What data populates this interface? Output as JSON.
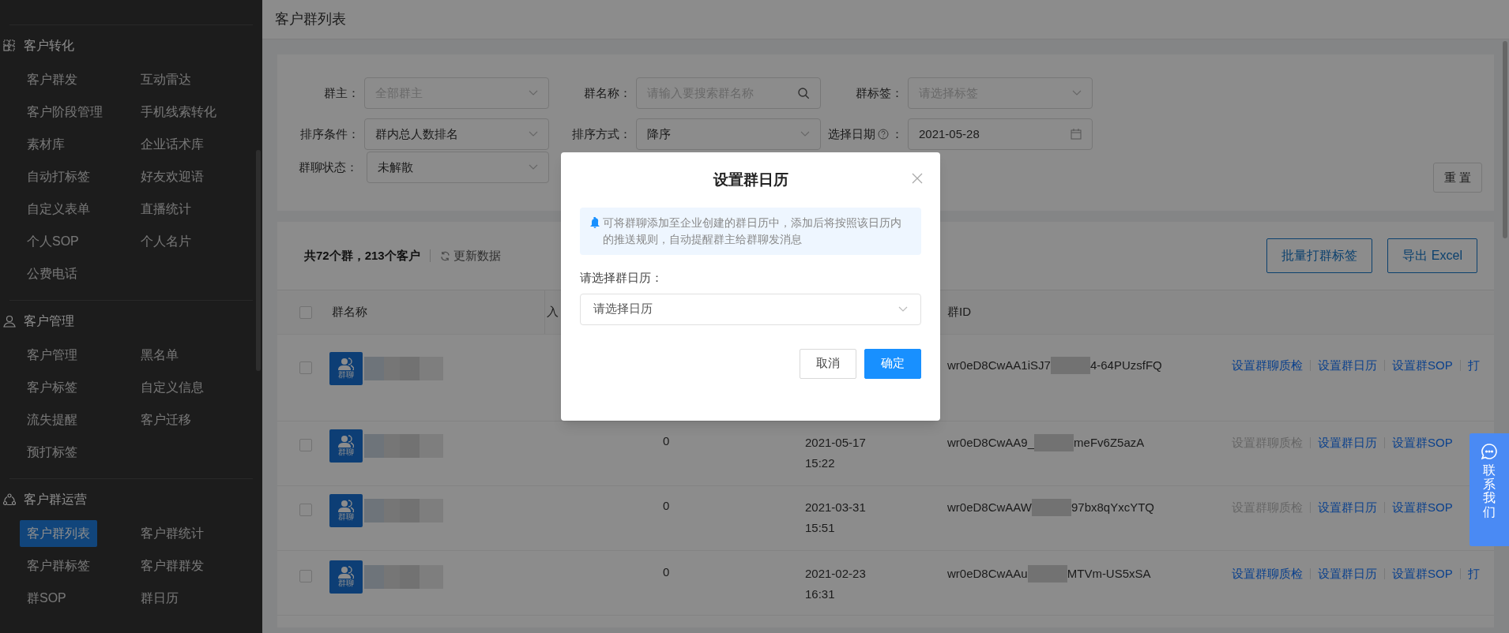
{
  "sidebar": {
    "sections": [
      {
        "title": "客户转化",
        "items": [
          {
            "label": "客户群发",
            "selected": false
          },
          {
            "label": "互动雷达",
            "selected": false
          },
          {
            "label": "客户阶段管理",
            "selected": false
          },
          {
            "label": "手机线索转化",
            "selected": false
          },
          {
            "label": "素材库",
            "selected": false
          },
          {
            "label": "企业话术库",
            "selected": false
          },
          {
            "label": "自动打标签",
            "selected": false
          },
          {
            "label": "好友欢迎语",
            "selected": false
          },
          {
            "label": "自定义表单",
            "selected": false
          },
          {
            "label": "直播统计",
            "selected": false
          },
          {
            "label": "个人SOP",
            "selected": false
          },
          {
            "label": "个人名片",
            "selected": false
          },
          {
            "label": "公费电话",
            "selected": false
          }
        ]
      },
      {
        "title": "客户管理",
        "items": [
          {
            "label": "客户管理",
            "selected": false
          },
          {
            "label": "黑名单",
            "selected": false
          },
          {
            "label": "客户标签",
            "selected": false
          },
          {
            "label": "自定义信息",
            "selected": false
          },
          {
            "label": "流失提醒",
            "selected": false
          },
          {
            "label": "客户迁移",
            "selected": false
          },
          {
            "label": "预打标签",
            "selected": false
          }
        ]
      },
      {
        "title": "客户群运营",
        "items": [
          {
            "label": "客户群列表",
            "selected": true
          },
          {
            "label": "客户群统计",
            "selected": false
          },
          {
            "label": "客户群标签",
            "selected": false
          },
          {
            "label": "客户群群发",
            "selected": false
          },
          {
            "label": "群SOP",
            "selected": false
          },
          {
            "label": "群日历",
            "selected": false
          }
        ]
      }
    ]
  },
  "page_header": {
    "title": "客户群列表"
  },
  "filters": [
    {
      "label": "群主：",
      "kind": "select",
      "placeholder": "全部群主",
      "help_icon": false
    },
    {
      "label": "群名称：",
      "kind": "search",
      "placeholder": "请输入要搜索群名称",
      "help_icon": false
    },
    {
      "label": "群标签：",
      "kind": "select",
      "placeholder": "请选择标签",
      "help_icon": false
    },
    {
      "label": "排序条件：",
      "kind": "select",
      "value": "群内总人数排名",
      "help_icon": false
    },
    {
      "label": "排序方式：",
      "kind": "select",
      "value": "降序",
      "help_icon": false
    },
    {
      "label": "选择日期",
      "kind": "date",
      "value": "2021-05-28",
      "help_icon": true,
      "label_suffix": "："
    },
    {
      "label": "群聊状态：",
      "kind": "select",
      "value": "未解散",
      "help_icon": false
    }
  ],
  "reset_button": "重 置",
  "summary": {
    "text": "共72个群，213个客户",
    "refresh": "更新数据"
  },
  "toolbar_buttons": [
    "批量打群标签",
    "导出 Excel"
  ],
  "table": {
    "all_checked": false,
    "header": {
      "name": "群名称",
      "column_2": "入",
      "group_id": "群ID"
    },
    "rows": [
      {
        "checked": false,
        "avatar_label": "群聊",
        "id_start": "wr0eD8CwAA1iSJ7",
        "id_end": "4-64PUzsfFQ",
        "actions": [
          {
            "label": "设置群聊质检",
            "disabled": false
          },
          {
            "label": "设置群日历",
            "disabled": false
          },
          {
            "label": "设置群SOP",
            "disabled": false
          },
          {
            "label": "打",
            "disabled": false
          }
        ]
      },
      {
        "checked": false,
        "avatar_label": "群聊",
        "count": "0",
        "date": "2021-05-17",
        "time": "15:22",
        "id_start": "wr0eD8CwAA9_",
        "id_end": "meFv6Z5azA",
        "actions": [
          {
            "label": "设置群聊质检",
            "disabled": true
          },
          {
            "label": "设置群日历",
            "disabled": false
          },
          {
            "label": "设置群SOP",
            "disabled": false
          }
        ]
      },
      {
        "checked": false,
        "avatar_label": "群聊",
        "count": "0",
        "date": "2021-03-31",
        "time": "15:51",
        "id_start": "wr0eD8CwAAW",
        "id_end": "97bx8qYxcYTQ",
        "actions": [
          {
            "label": "设置群聊质检",
            "disabled": true
          },
          {
            "label": "设置群日历",
            "disabled": false
          },
          {
            "label": "设置群SOP",
            "disabled": false
          }
        ]
      },
      {
        "checked": false,
        "avatar_label": "群聊",
        "count": "0",
        "date": "2021-02-23",
        "time": "16:31",
        "id_start": "wr0eD8CwAAu",
        "id_end": "MTVm-US5xSA",
        "actions": [
          {
            "label": "设置群聊质检",
            "disabled": false
          },
          {
            "label": "设置群日历",
            "disabled": false
          },
          {
            "label": "设置群SOP",
            "disabled": false
          },
          {
            "label": "打",
            "disabled": false
          }
        ]
      }
    ]
  },
  "modal": {
    "title": "设置群日历",
    "notice": "可将群聊添加至企业创建的群日历中，添加后将按照该日历内的推送规则，自动提醒群主给群聊发消息",
    "field_label": "请选择群日历：",
    "select_placeholder": "请选择日历",
    "buttons": [
      {
        "label": "取消",
        "kind": "default"
      },
      {
        "label": "确定",
        "kind": "primary"
      }
    ]
  },
  "contact_widget": {
    "label": "联系我们"
  }
}
